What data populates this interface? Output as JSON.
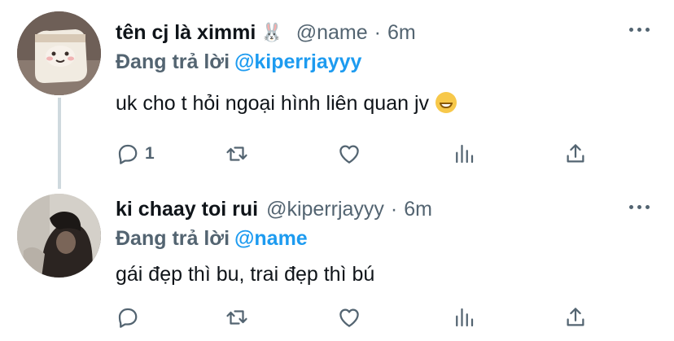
{
  "tweets": [
    {
      "display_name": "tên cj là ximmi",
      "name_emoji": "🐰",
      "handle": "@name",
      "separator": "·",
      "time": "6m",
      "replying_label": "Đang trả lời",
      "replying_to": "@kiperrjayyy",
      "text": "uk cho t hỏi ngoại hình liên quan jv",
      "reply_count": "1"
    },
    {
      "display_name": "ki chaay toi rui",
      "handle": "@kiperrjayyy",
      "separator": "·",
      "time": "6m",
      "replying_label": "Đang trả lời",
      "replying_to": "@name",
      "text": "gái đẹp thì bu, trai đẹp thì bú",
      "reply_count": ""
    }
  ],
  "icons": {
    "reply": "reply-icon",
    "retweet": "retweet-icon",
    "like": "like-icon",
    "stats": "stats-icon",
    "share": "share-icon",
    "more": "more-icon"
  },
  "colors": {
    "accent": "#1d9bf0",
    "secondary_text": "#536471",
    "primary_text": "#0f1419",
    "thread_line": "#cfd9de"
  }
}
